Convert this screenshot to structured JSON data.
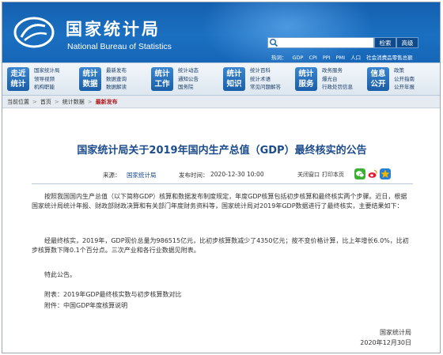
{
  "header": {
    "title": "国家统计局",
    "subtitle": "National Bureau of Statistics",
    "search_button": "检索",
    "advanced_button": "高级",
    "hotkeys": [
      "热词：",
      "GDP",
      "CPI",
      "PPI",
      "PMI",
      "人口",
      "社会消费品零售总额"
    ]
  },
  "nav": [
    {
      "badge": [
        "走近",
        "统计"
      ],
      "links": [
        "国家统计局",
        "领导视频",
        "机构职能"
      ]
    },
    {
      "badge": [
        "统计",
        "数据"
      ],
      "links": [
        "最新发布",
        "数据查询",
        "数据解读"
      ]
    },
    {
      "badge": [
        "统计",
        "工作"
      ],
      "links": [
        "统计动态",
        "通知公告",
        "国务院"
      ]
    },
    {
      "badge": [
        "统计",
        "知识"
      ],
      "links": [
        "统计百科",
        "统计术语",
        "常见问题解答"
      ]
    },
    {
      "badge": [
        "统计",
        "服务"
      ],
      "links": [
        "政务服务",
        "爆光台",
        "行政处罚信息"
      ]
    },
    {
      "badge": [
        "信息",
        "公开"
      ],
      "links": [
        "政策",
        "公开指南",
        "公开年报"
      ]
    }
  ],
  "breadcrumb": {
    "prefix": "当前位置",
    "home": "首页",
    "section": "统计数据",
    "current": "最新发布"
  },
  "article": {
    "title": "国家统计局关于2019年国内生产总值（GDP）最终核实的公告",
    "source_label": "来源：",
    "source": "国家统计局",
    "date_label": "发布时间：",
    "date": "2020-12-30  10:00",
    "close_window": "关闭窗口",
    "print_page": "打印本页",
    "p1": "按照我国国内生产总值（以下简称GDP）核算和数据发布制度规定，年度GDP核算包括初步核算和最终核实两个步骤。近日，根据国家统计局统计年报、财政部财政决算和有关部门年度财务资料等，国家统计局对2019年GDP数据进行了最终核实，主要结果如下：",
    "p2": "经最终核实，2019年，GDP现价总量为986515亿元，比初步核算数减少了4350亿元；按不变价格计算，比上年增长6.0%，比初步核算数下降0.1个百分点。三次产业和各行业数据见附表。",
    "p3": "特此公告。",
    "attach1": "附表：2019年GDP最终核实数与初步核算数对比",
    "attach2": "附件：中国GDP年度核算说明",
    "sign_org": "国家统计局",
    "sign_date": "2020年12月30日"
  },
  "colors": {
    "header_blue": "#1766b8",
    "title_blue": "#1c4c8c",
    "crumb_red": "#b0181c",
    "wechat_green": "#3cb034",
    "weibo_red": "#e6162d",
    "fav_yellow": "#f2b500"
  },
  "icons": [
    "logo-icon",
    "search-icon",
    "wechat-share-icon",
    "weibo-share-icon",
    "favorite-star-icon"
  ]
}
